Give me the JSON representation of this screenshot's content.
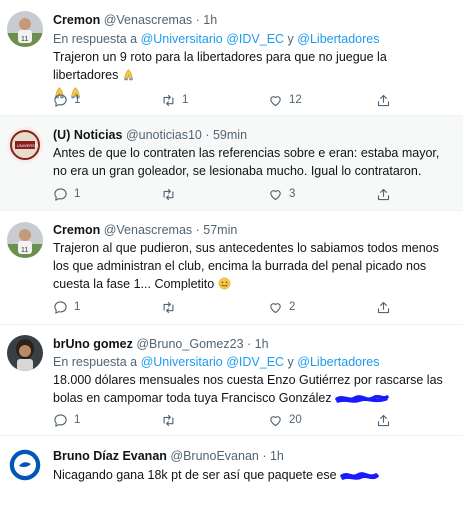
{
  "tweets": [
    {
      "name": "Cremon",
      "meta": "@Venascremas · 1h",
      "reply_prefix": "En respuesta a",
      "mention1": "@Universitario",
      "mention2": "@IDV_EC",
      "reply_and": "y",
      "mention3": "@Libertadores",
      "text": "Trajeron un 9 roto para la libertadores para que no juegue la libertadores",
      "replies": "1",
      "retweets": "1",
      "likes": "12"
    },
    {
      "name": "(U) Noticias",
      "meta": "@unoticias10 · 59min",
      "text": "Antes de que lo contraten las referencias sobre e eran: estaba mayor, no era un gran goleador, se lesionaba mucho. Igual lo contrataron.",
      "replies": "1",
      "likes": "3"
    },
    {
      "name": "Cremon",
      "meta": "@Venascremas · 57min",
      "text": "Trajeron al que pudieron, sus antecedentes lo sabiamos todos menos los que administran el club, encima la burrada del penal picado nos cuesta la fase 1... Completito",
      "replies": "1",
      "likes": "2"
    },
    {
      "name": "brUno gomez",
      "meta": "@Bruno_Gomez23 · 1h",
      "reply_prefix": "En respuesta a",
      "mention1": "@Universitario",
      "mention2": "@IDV_EC",
      "reply_and": "y",
      "mention3": "@Libertadores",
      "text": "18.000 dólares mensuales nos cuesta Enzo Gutiérrez por rascarse las bolas en campomar toda tuya Francisco González",
      "replies": "1",
      "likes": "20"
    },
    {
      "name": "Bruno Díaz Evanan",
      "meta": "@BrunoEvanan · 1h",
      "text": "Nicagando gana 18k pt de ser así que paquete ese"
    }
  ],
  "colors": {
    "accent": "#1d9bf0",
    "secondary_text": "#536471",
    "border": "#eff3f4",
    "shaded_bg": "#f7f9f9"
  },
  "icons": [
    "reply-icon",
    "retweet-icon",
    "like-icon",
    "share-icon"
  ]
}
